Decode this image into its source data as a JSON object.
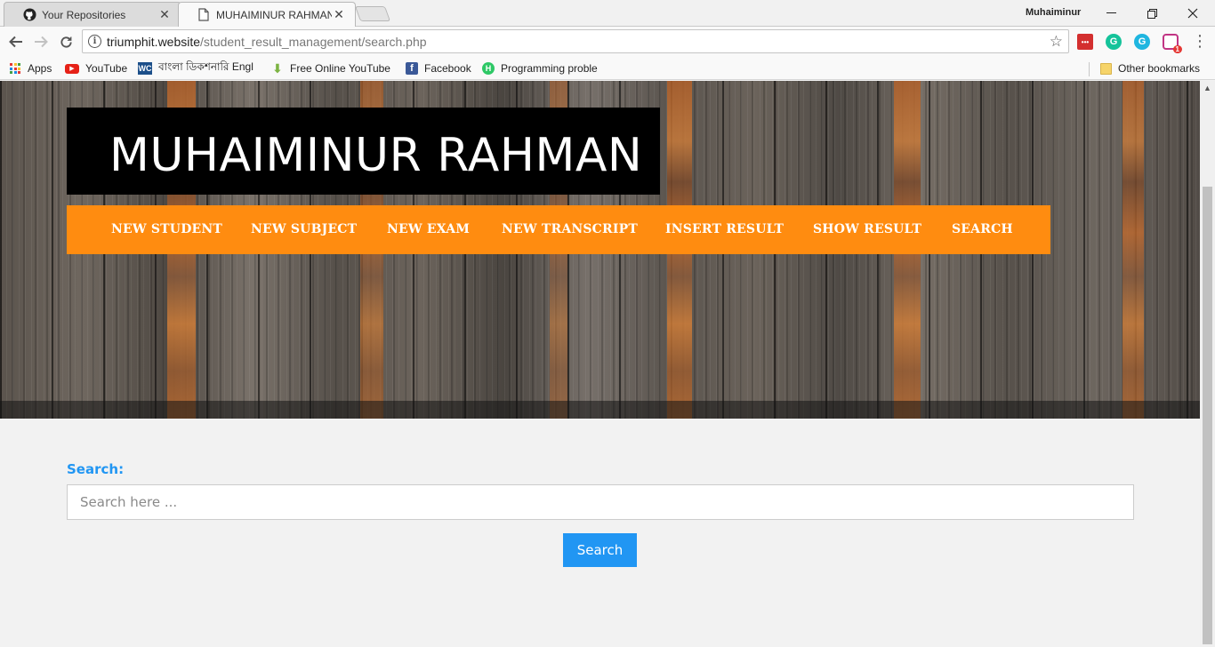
{
  "browser": {
    "tabs": [
      {
        "title": "Your Repositories",
        "icon": "github-icon",
        "active": false
      },
      {
        "title": "MUHAIMINUR RAHMAN",
        "icon": "page-icon",
        "active": true
      }
    ],
    "profile_name": "Muhaiminur",
    "url_host": "triumphit.website",
    "url_path": "/student_result_management/search.php",
    "extension_badge": "1"
  },
  "bookmarks": {
    "items": [
      {
        "label": "Apps",
        "icon": "apps-grid-icon"
      },
      {
        "label": "YouTube",
        "icon": "youtube-icon"
      },
      {
        "label": "বাংলা ডিকশনারি Engl",
        "icon": "wc-dictionary-icon"
      },
      {
        "label": "Free Online YouTube",
        "icon": "download-arrow-icon"
      },
      {
        "label": "Facebook",
        "icon": "facebook-icon"
      },
      {
        "label": "Programming proble",
        "icon": "hackerrank-icon"
      }
    ],
    "other_label": "Other bookmarks"
  },
  "site": {
    "title": "MUHAIMINUR RAHMAN",
    "nav": [
      "NEW STUDENT",
      "NEW SUBJECT",
      "NEW EXAM",
      "NEW TRANSCRIPT",
      "INSERT RESULT",
      "SHOW RESULT",
      "SEARCH"
    ]
  },
  "search": {
    "label": "Search:",
    "placeholder": "Search here ...",
    "value": "",
    "button_label": "Search"
  },
  "colors": {
    "nav_background": "#ff8c10",
    "accent_blue": "#2196f3",
    "title_box": "#000000"
  }
}
